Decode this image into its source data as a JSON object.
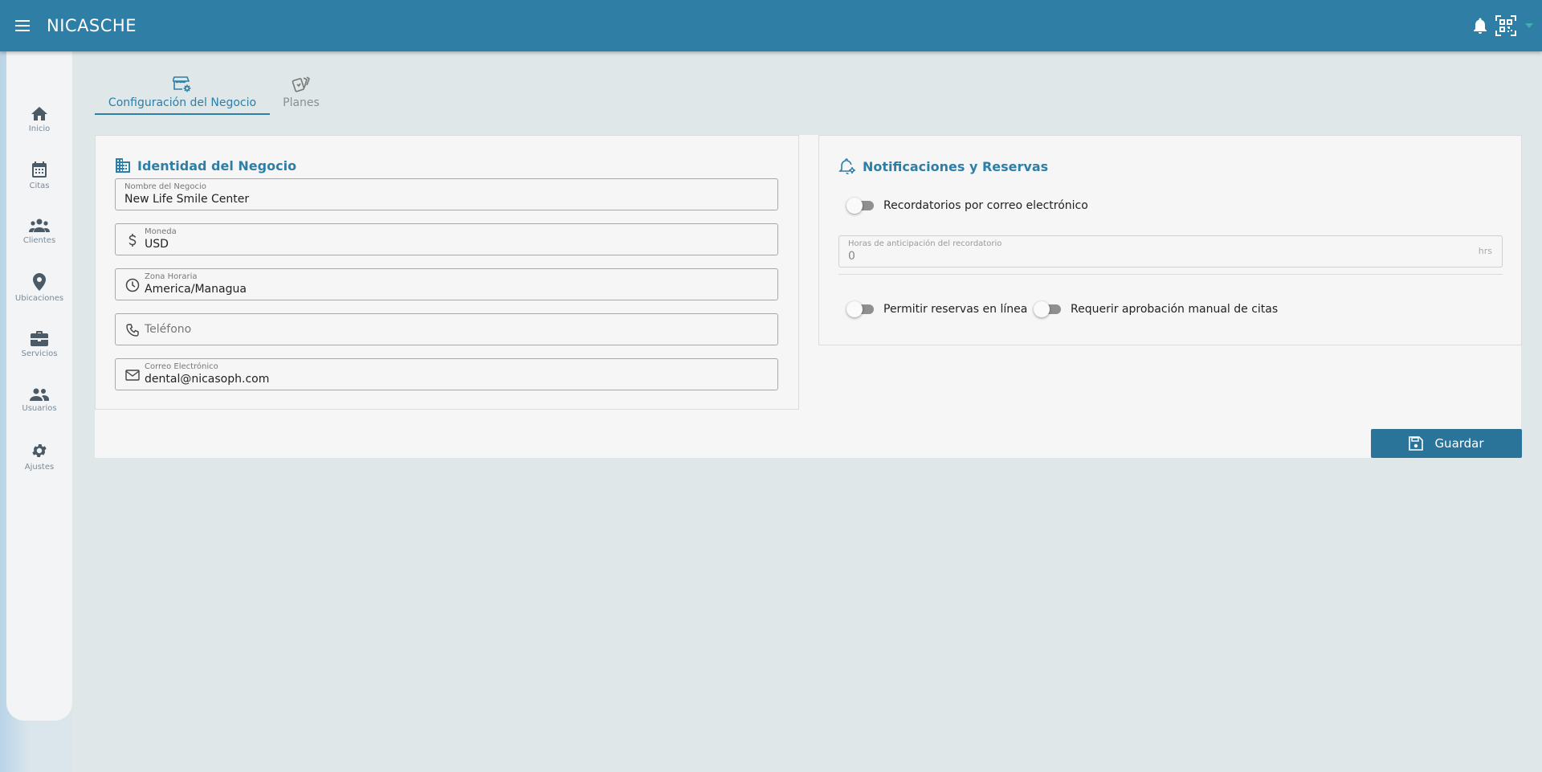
{
  "app": {
    "title": "NICASCHE"
  },
  "sidebar": {
    "items": [
      {
        "label": "Inicio",
        "icon": "home-icon"
      },
      {
        "label": "Citas",
        "icon": "calendar-icon"
      },
      {
        "label": "Clientes",
        "icon": "group-icon"
      },
      {
        "label": "Ubicaciones",
        "icon": "location-pin-icon"
      },
      {
        "label": "Servicios",
        "icon": "briefcase-icon"
      },
      {
        "label": "Usuarios",
        "icon": "users-icon"
      },
      {
        "label": "Ajustes",
        "icon": "gear-icon"
      }
    ]
  },
  "tabs": [
    {
      "label": "Configuración del Negocio",
      "icon": "store-settings-icon",
      "active": true
    },
    {
      "label": "Planes",
      "icon": "cards-icon",
      "active": false
    }
  ],
  "identity": {
    "title": "Identidad del Negocio",
    "fields": [
      {
        "label": "Nombre del Negocio",
        "value": "New Life Smile Center"
      },
      {
        "label": "Moneda",
        "value": "USD",
        "icon": "dollar-icon"
      },
      {
        "label": "Zona Horaria",
        "value": "America/Managua",
        "icon": "clock-icon"
      },
      {
        "placeholder": "Teléfono",
        "icon": "phone-icon"
      },
      {
        "label": "Correo Electrónico",
        "value": "dental@nicasoph.com",
        "icon": "mail-icon"
      }
    ]
  },
  "notifications": {
    "title": "Notificaciones y Reservas",
    "email_reminders_label": "Recordatorios por correo electrónico",
    "reminder_hours": {
      "label": "Horas de anticipación del recordatorio",
      "value": "0",
      "suffix": "hrs"
    },
    "online_booking_label": "Permitir reservas en línea",
    "manual_approval_label": "Requerir aprobación manual de citas"
  },
  "actions": {
    "save_label": "Guardar"
  },
  "colors": {
    "primary": "#2e7ea6",
    "button": "#2a7399",
    "background": "#dfe7e9",
    "card": "#f6f6f6"
  }
}
